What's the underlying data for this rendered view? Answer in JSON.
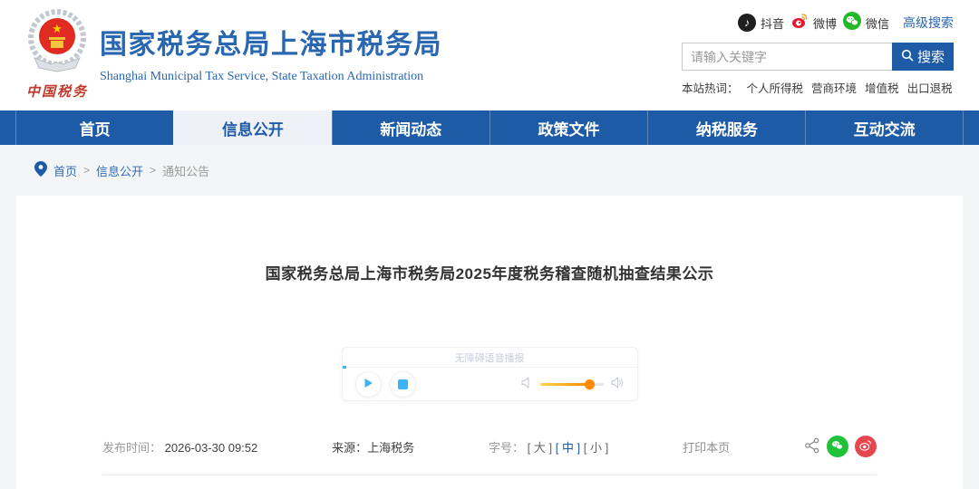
{
  "header": {
    "logo_caption": "中国税务",
    "site_title": "国家税务总局上海市税务局",
    "site_subtitle": "Shanghai Municipal Tax Service, State Taxation Administration",
    "social": [
      {
        "icon": "douyin-icon",
        "label": "抖音"
      },
      {
        "icon": "weibo-icon",
        "label": "微博"
      },
      {
        "icon": "wechat-icon",
        "label": "微信"
      }
    ],
    "advanced_search": "高级搜索",
    "search": {
      "placeholder": "请输入关键字",
      "button_label": "搜索"
    },
    "hot_words": {
      "label": "本站热词：",
      "items": [
        "个人所得税",
        "营商环境",
        "增值税",
        "出口退税"
      ]
    }
  },
  "nav": {
    "items": [
      {
        "label": "首页",
        "active": false
      },
      {
        "label": "信息公开",
        "active": true
      },
      {
        "label": "新闻动态",
        "active": false
      },
      {
        "label": "政策文件",
        "active": false
      },
      {
        "label": "纳税服务",
        "active": false
      },
      {
        "label": "互动交流",
        "active": false
      }
    ]
  },
  "breadcrumb": {
    "separator": ">",
    "items": [
      "首页",
      "信息公开",
      "通知公告"
    ]
  },
  "article": {
    "title": "国家税务总局上海市税务局2025年度税务稽查随机抽查结果公示",
    "player": {
      "title": "无障碍语音播报",
      "volume_percent": 78
    },
    "meta": {
      "publish_label": "发布时间：",
      "publish_value": "2026-03-30 09:52",
      "source": "来源：上海税务",
      "fontsize_label": "字号：",
      "fontsize_options": [
        "[ 大 ]",
        "[ 中 ]",
        "[ 小 ]"
      ],
      "fontsize_active": "中",
      "print_label": "打印本页"
    }
  },
  "colors": {
    "brand_blue": "#1d5ba6",
    "title_blue": "#2a67b1",
    "accent_cyan": "#3ab4f2",
    "slider_orange": "#ff8a00",
    "wechat_green": "#21c23a",
    "weibo_red": "#e6464d",
    "douyin_black": "#1f1f1f"
  }
}
